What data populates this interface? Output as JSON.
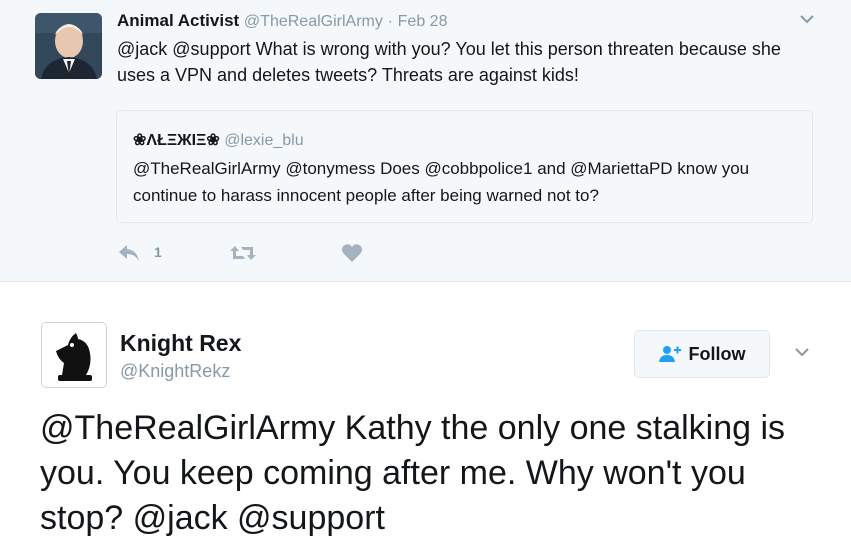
{
  "quoting_tweet": {
    "author_name": "Animal Activist",
    "handle": "@TheRealGirlArmy",
    "separator": "·",
    "date": "Feb 28",
    "text": "@jack @support What is wrong with you? You let this person threaten because she uses a VPN and deletes tweets? Threats are against kids!",
    "quoted": {
      "author_name": "❀ΛŁΞЖΙΞ❀",
      "handle": "@lexie_blu",
      "text": "@TheRealGirlArmy @tonymess Does @cobbpolice1 and @MariettaPD know you continue to harass innocent people after being warned not to?"
    },
    "actions": {
      "reply_icon": "reply-icon",
      "reply_count": "1",
      "retweet_icon": "retweet-icon",
      "like_icon": "heart-icon"
    },
    "avatar_icon": "profile-photo",
    "menu_icon": "chevron-down-icon"
  },
  "main_tweet": {
    "author_name": "Knight Rex",
    "handle": "@KnightRekz",
    "follow_label": "Follow",
    "follow_icon": "add-person-icon",
    "menu_icon": "chevron-down-icon",
    "avatar_icon": "chess-knight-icon",
    "text": "@TheRealGirlArmy Kathy the only one stalking is you. You keep coming after me. Why won't you stop? @jack @support"
  },
  "colors": {
    "background_top": "#f5f8fa",
    "text": "#14171a",
    "muted": "#8899a6",
    "border": "#e1e8ed",
    "accent": "#1da1f2"
  }
}
